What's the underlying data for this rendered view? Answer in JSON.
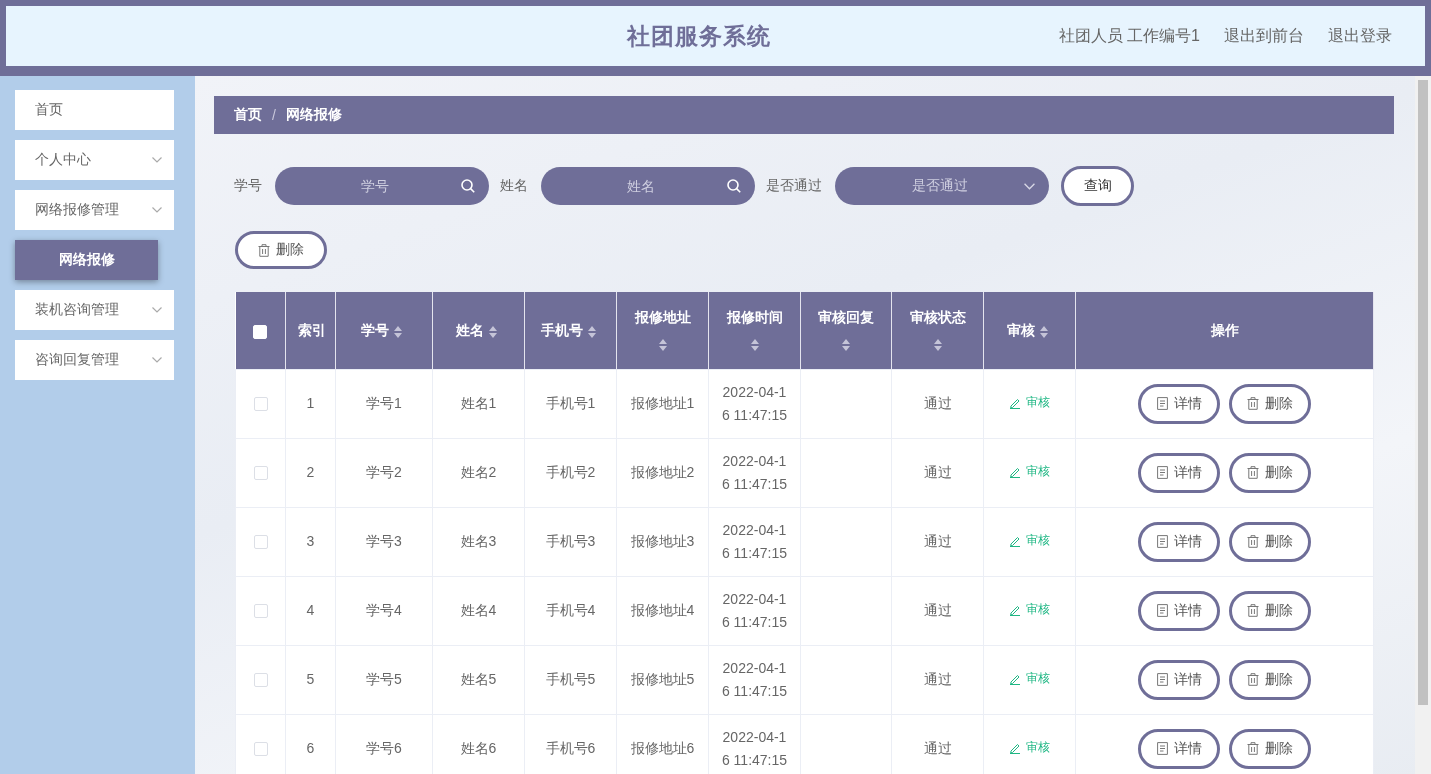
{
  "header": {
    "title": "社团服务系统",
    "user": "社团人员 工作编号1",
    "links": [
      "退出到前台",
      "退出登录"
    ]
  },
  "sidebar": {
    "items": [
      {
        "label": "首页",
        "kind": "link"
      },
      {
        "label": "个人中心",
        "kind": "menu"
      },
      {
        "label": "网络报修管理",
        "kind": "menu",
        "children": [
          {
            "label": "网络报修",
            "selected": true
          }
        ]
      },
      {
        "label": "装机咨询管理",
        "kind": "menu"
      },
      {
        "label": "咨询回复管理",
        "kind": "menu"
      }
    ]
  },
  "breadcrumb": {
    "items": [
      "首页",
      "网络报修"
    ],
    "separator": "/"
  },
  "filters": [
    {
      "kind": "text",
      "label": "学号",
      "placeholder": "学号"
    },
    {
      "kind": "text",
      "label": "姓名",
      "placeholder": "姓名"
    },
    {
      "kind": "select",
      "label": "是否通过",
      "placeholder": "是否通过"
    }
  ],
  "search_button": "查询",
  "toolbar": {
    "delete_button": "删除"
  },
  "table": {
    "select_all": {
      "checked": false
    },
    "columns": [
      {
        "label": "索引",
        "sortable": false
      },
      {
        "label": "学号",
        "sortable": true
      },
      {
        "label": "姓名",
        "sortable": true
      },
      {
        "label": "手机号",
        "sortable": true
      },
      {
        "label": "报修地址",
        "sortable": true
      },
      {
        "label": "报修时间",
        "sortable": true
      },
      {
        "label": "审核回复",
        "sortable": true
      },
      {
        "label": "审核状态",
        "sortable": true
      },
      {
        "label": "审核",
        "sortable": true
      },
      {
        "label": "操作",
        "sortable": false
      }
    ],
    "rows": [
      {
        "selected": false,
        "index": "1",
        "student_id": "学号1",
        "name": "姓名1",
        "phone": "手机号1",
        "address": "报修地址1",
        "time": "2022-04-16 11:47:15",
        "status": "通过",
        "review": "审核",
        "actions": [
          {
            "kind": "detail",
            "label": "详情"
          },
          {
            "kind": "delete",
            "label": "删除"
          }
        ]
      },
      {
        "selected": false,
        "index": "2",
        "student_id": "学号2",
        "name": "姓名2",
        "phone": "手机号2",
        "address": "报修地址2",
        "time": "2022-04-16 11:47:15",
        "status": "通过",
        "review": "审核",
        "actions": [
          {
            "kind": "detail",
            "label": "详情"
          },
          {
            "kind": "delete",
            "label": "删除"
          }
        ]
      },
      {
        "selected": false,
        "index": "3",
        "student_id": "学号3",
        "name": "姓名3",
        "phone": "手机号3",
        "address": "报修地址3",
        "time": "2022-04-16 11:47:15",
        "status": "通过",
        "review": "审核",
        "actions": [
          {
            "kind": "detail",
            "label": "详情"
          },
          {
            "kind": "delete",
            "label": "删除"
          }
        ]
      },
      {
        "selected": false,
        "index": "4",
        "student_id": "学号4",
        "name": "姓名4",
        "phone": "手机号4",
        "address": "报修地址4",
        "time": "2022-04-16 11:47:15",
        "status": "通过",
        "review": "审核",
        "actions": [
          {
            "kind": "detail",
            "label": "详情"
          },
          {
            "kind": "delete",
            "label": "删除"
          }
        ]
      },
      {
        "selected": false,
        "index": "5",
        "student_id": "学号5",
        "name": "姓名5",
        "phone": "手机号5",
        "address": "报修地址5",
        "time": "2022-04-16 11:47:15",
        "status": "通过",
        "review": "审核",
        "actions": [
          {
            "kind": "detail",
            "label": "详情"
          },
          {
            "kind": "delete",
            "label": "删除"
          }
        ]
      },
      {
        "selected": false,
        "index": "6",
        "student_id": "学号6",
        "name": "姓名6",
        "phone": "手机号6",
        "address": "报修地址6",
        "time": "2022-04-16 11:47:15",
        "status": "通过",
        "review": "审核",
        "actions": [
          {
            "kind": "detail",
            "label": "详情"
          },
          {
            "kind": "delete",
            "label": "删除"
          }
        ]
      }
    ]
  }
}
